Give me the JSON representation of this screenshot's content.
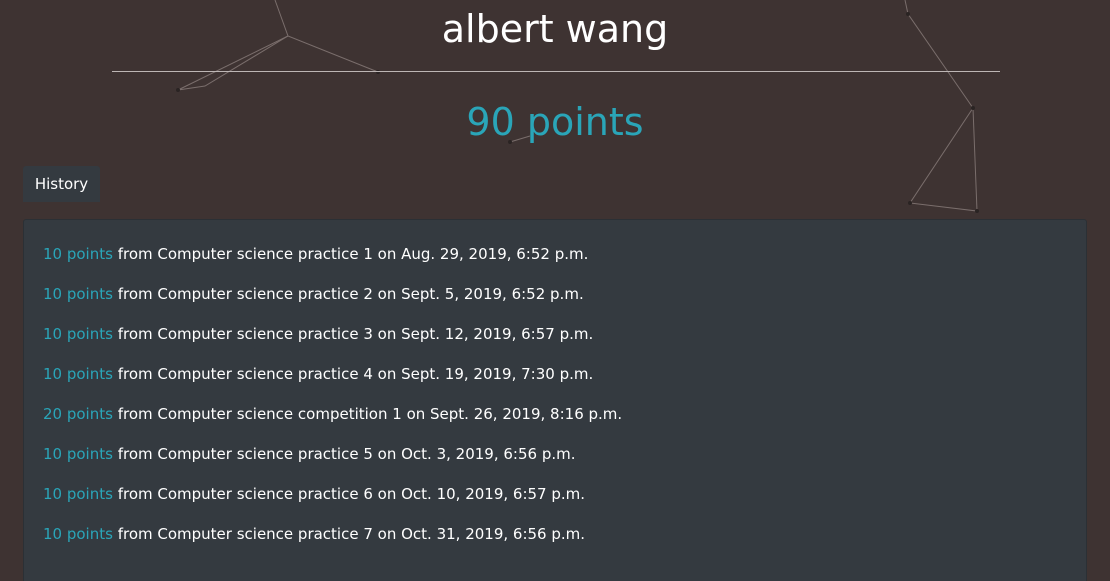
{
  "profile": {
    "name": "albert wang",
    "points_total": "90 points"
  },
  "tabs": {
    "history_label": "History"
  },
  "history": [
    {
      "points": "10 points",
      "text": " from Computer science practice 1 on Aug. 29, 2019, 6:52 p.m."
    },
    {
      "points": "10 points",
      "text": " from Computer science practice 2 on Sept. 5, 2019, 6:52 p.m."
    },
    {
      "points": "10 points",
      "text": " from Computer science practice 3 on Sept. 12, 2019, 6:57 p.m."
    },
    {
      "points": "10 points",
      "text": " from Computer science practice 4 on Sept. 19, 2019, 7:30 p.m."
    },
    {
      "points": "20 points",
      "text": " from Computer science competition 1 on Sept. 26, 2019, 8:16 p.m."
    },
    {
      "points": "10 points",
      "text": " from Computer science practice 5 on Oct. 3, 2019, 6:56 p.m."
    },
    {
      "points": "10 points",
      "text": " from Computer science practice 6 on Oct. 10, 2019, 6:57 p.m."
    },
    {
      "points": "10 points",
      "text": " from Computer science practice 7 on Oct. 31, 2019, 6:56 p.m."
    }
  ],
  "colors": {
    "background": "#3e3332",
    "panel": "#343a40",
    "accent": "#2aa5b8",
    "text": "#ffffff"
  }
}
